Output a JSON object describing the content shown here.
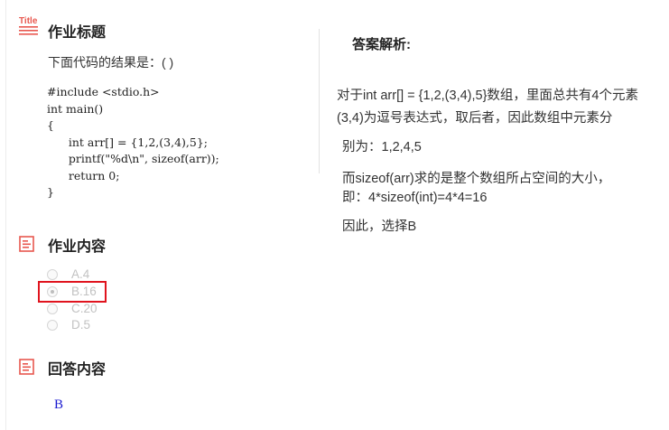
{
  "homework_title": {
    "icon_label": "Title",
    "heading": "作业标题",
    "question": "下面代码的结果是：( )",
    "code_lines": [
      "#include <stdio.h>",
      "int main()",
      "{",
      "      int arr[] = {1,2,(3,4),5};",
      "      printf(\"%d\\n\", sizeof(arr));",
      "      return 0;",
      "}"
    ]
  },
  "homework_content": {
    "heading": "作业内容",
    "options": [
      {
        "label": "A.4",
        "selected": false
      },
      {
        "label": "B.16",
        "selected": true
      },
      {
        "label": "C.20",
        "selected": false
      },
      {
        "label": "D.5",
        "selected": false
      }
    ]
  },
  "answer_content": {
    "heading": "回答内容",
    "answer": "B"
  },
  "analysis": {
    "heading": "答案解析:",
    "line1": "对于int arr[] = {1,2,(3,4),5}数组，里面总共有4个元素",
    "line2": "(3,4)为逗号表达式，取后者，因此数组中元素分",
    "line3": "别为：1,2,4,5",
    "line4": "而sizeof(arr)求的是整个数组所占空间的大小，",
    "line5": "即：4*sizeof(int)=4*4=16",
    "line6": "因此，选择B"
  },
  "colors": {
    "icon_red": "#e8584f",
    "highlight_red": "#e0141e",
    "answer_blue": "#1a1ad0"
  }
}
